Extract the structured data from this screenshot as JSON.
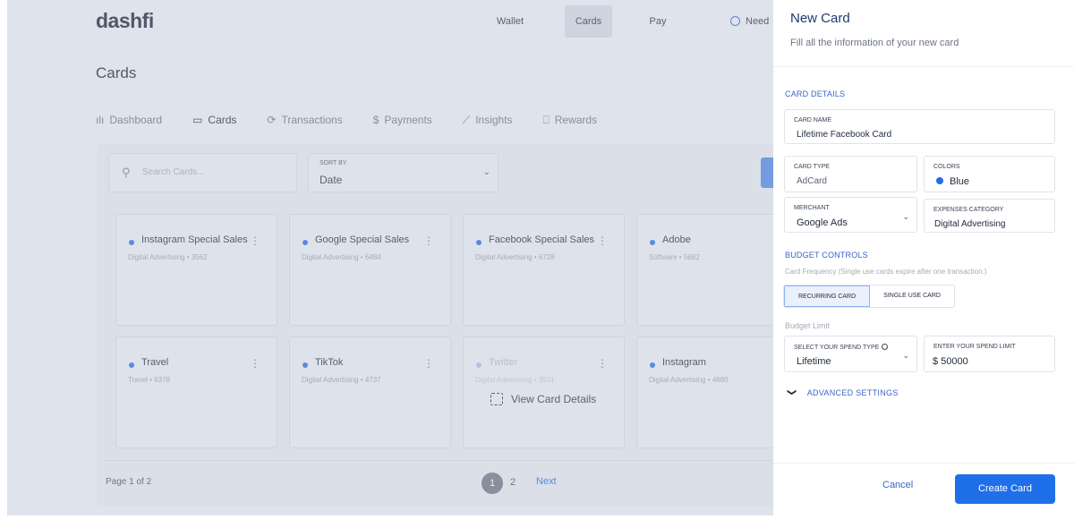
{
  "app": {
    "logo": "dashfi",
    "nav": {
      "wallet": "Wallet",
      "cards": "Cards",
      "pay": "Pay",
      "need": "Need"
    },
    "page_title": "Cards",
    "subnav": [
      {
        "label": "Dashboard",
        "icon": "bar-chart-icon"
      },
      {
        "label": "Cards",
        "icon": "card-icon"
      },
      {
        "label": "Transactions",
        "icon": "refresh-icon"
      },
      {
        "label": "Payments",
        "icon": "dollar-icon"
      },
      {
        "label": "Insights",
        "icon": "trend-icon"
      },
      {
        "label": "Rewards",
        "icon": "gift-icon"
      }
    ],
    "search": {
      "placeholder": "Search Cards..."
    },
    "sort": {
      "label": "SORT BY",
      "value": "Date"
    },
    "cards": [
      {
        "name": "Instagram Special Sales",
        "sub": "Digital Advertising • 3562"
      },
      {
        "name": "Google Special Sales",
        "sub": "Digital Advertising • 6484"
      },
      {
        "name": "Facebook Special Sales",
        "sub": "Digital Advertising • 6728"
      },
      {
        "name": "Adobe",
        "sub": "Software • 5682"
      },
      {
        "name": "Travel",
        "sub": "Travel • 9378"
      },
      {
        "name": "TikTok",
        "sub": "Digital Advertising • 4737"
      },
      {
        "name": "Twitter",
        "sub": "Digital Advertising • 3531",
        "hover_label": "View Card Details"
      },
      {
        "name": "Instagram",
        "sub": "Digital Advertising • 4680"
      }
    ],
    "pagination": {
      "info": "Page 1 of 2",
      "page1": "1",
      "page2": "2",
      "next": "Next"
    }
  },
  "drawer": {
    "title": "New Card",
    "subtitle": "Fill all the information of your new card",
    "card_details_heading": "CARD DETAILS",
    "card_name": {
      "label": "CARD NAME",
      "value": "Lifetime Facebook Card"
    },
    "card_type": {
      "label": "CARD TYPE",
      "value": "AdCard"
    },
    "colors": {
      "label": "COLORS",
      "value": "Blue",
      "swatch": "#1f6fe8"
    },
    "merchant": {
      "label": "MERCHANT",
      "value": "Google Ads"
    },
    "expenses_category": {
      "label": "EXPENSES CATEGORY",
      "value": "Digital Advertising"
    },
    "budget_heading": "BUDGET CONTROLS",
    "frequency_hint": "Card Frequency (Single use cards expire after one transaction.)",
    "frequency_options": [
      "RECURRING CARD",
      "SINGLE USE CARD"
    ],
    "budget_limit_label": "Budget Limit",
    "spend_type": {
      "label": "SELECT YOUR SPEND TYPE",
      "value": "Lifetime"
    },
    "spend_limit": {
      "label": "ENTER YOUR SPEND LIMIT",
      "value": "$ 50000"
    },
    "advanced": "ADVANCED SETTINGS",
    "cancel": "Cancel",
    "create": "Create Card"
  }
}
